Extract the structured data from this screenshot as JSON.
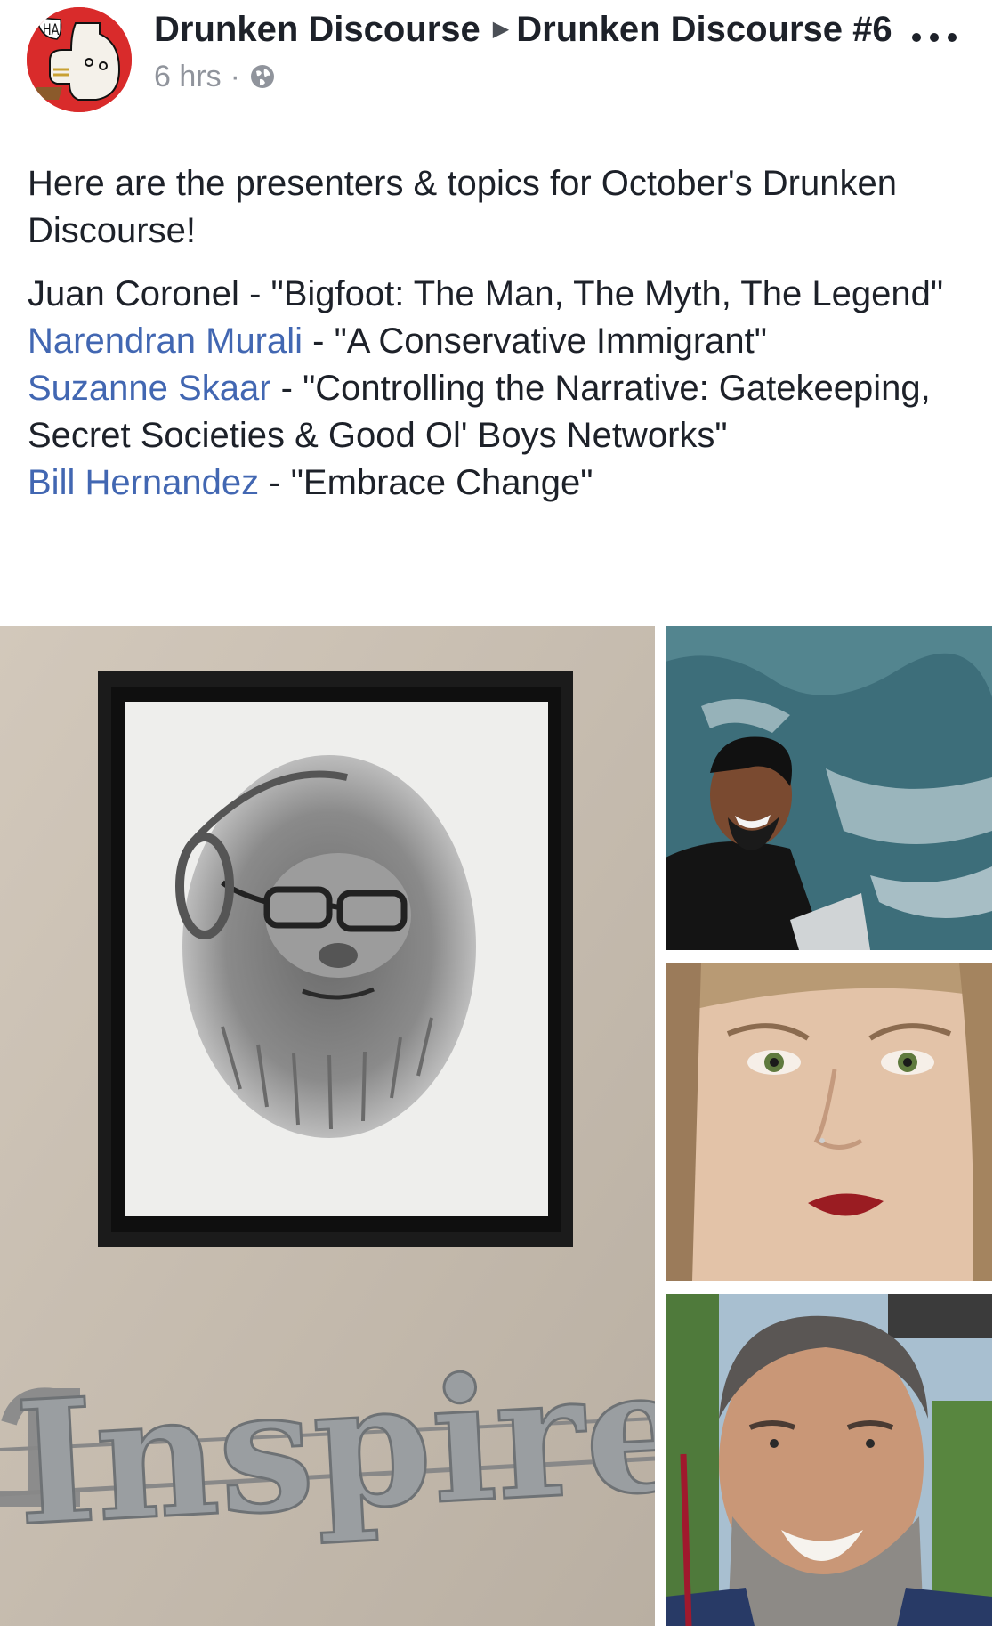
{
  "header": {
    "avatar_text": "HAI",
    "group_name": "Drunken Discourse",
    "event_name": "Drunken Discourse #6",
    "timestamp": "6 hrs",
    "separator": "·",
    "privacy_icon": "globe-icon",
    "more_icon": "more-options-icon"
  },
  "post": {
    "intro": "Here are the presenters & topics for October's Drunken Discourse!",
    "presenters": [
      {
        "name": "Juan Coronel",
        "topic": "- \"Bigfoot: The Man, The Myth, The Legend\"",
        "linked": false
      },
      {
        "name": "Narendran Murali",
        "topic": "- \"A Conservative Immigrant\"",
        "linked": true
      },
      {
        "name": "Suzanne Skaar",
        "topic": "- \"Controlling the Narrative: Gatekeeping, Secret Societies & Good Ol' Boys Networks\"",
        "linked": true
      },
      {
        "name": "Bill Hernandez",
        "topic": "- \"Embrace Change\"",
        "linked": true
      }
    ]
  },
  "photos": {
    "main_sign_text": "Inspire"
  },
  "colors": {
    "link": "#4267b2",
    "text": "#1d2129",
    "meta": "#90949c",
    "avatar_bg": "#d92b2b"
  }
}
